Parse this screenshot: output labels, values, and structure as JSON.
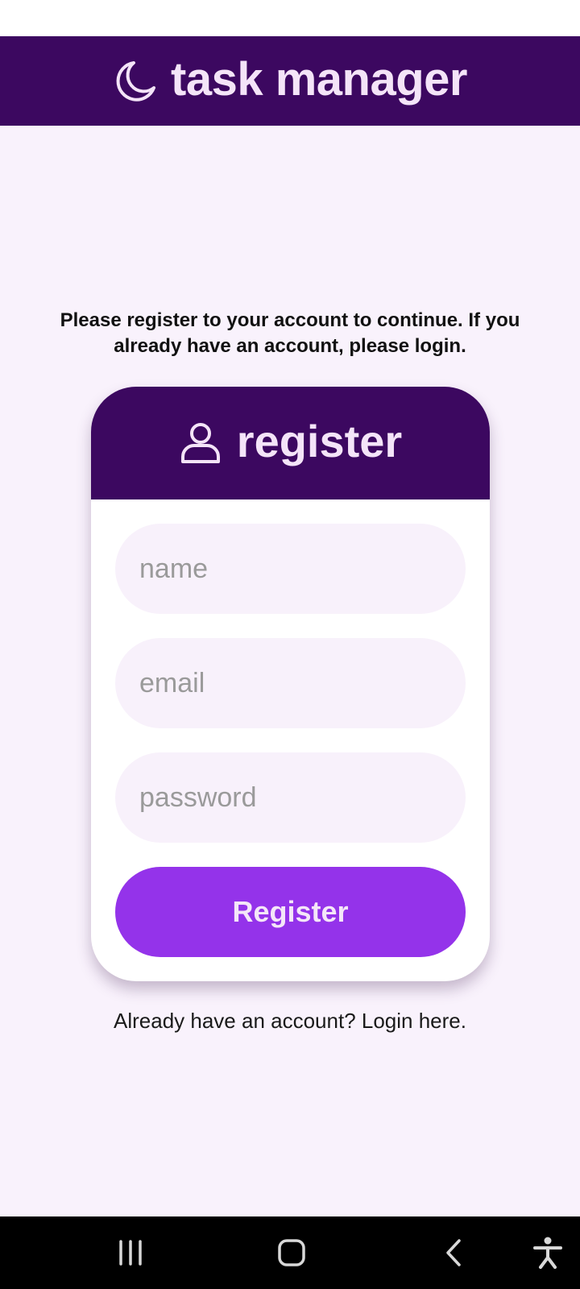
{
  "header": {
    "title": "task manager",
    "icon": "moon-icon"
  },
  "intro": {
    "text": "Please register to your account to continue. If you already have an account, please login."
  },
  "register_card": {
    "title": "register",
    "icon": "person-icon",
    "name_placeholder": "name",
    "email_placeholder": "email",
    "password_placeholder": "password",
    "submit_label": "Register"
  },
  "login_link": {
    "text": "Already have an account? Login here."
  },
  "navigation_bar": {
    "buttons": [
      "recent-apps-icon",
      "home-icon",
      "back-icon",
      "accessibility-icon"
    ]
  },
  "colors": {
    "primary_dark": "#3c0860",
    "accent": "#9433ea",
    "background": "#f9f2fc",
    "field_background": "#f8f1fb",
    "header_text": "#f4e4f8"
  }
}
